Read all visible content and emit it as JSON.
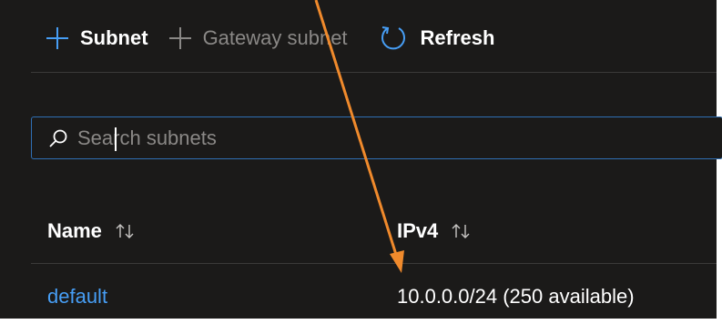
{
  "toolbar": {
    "subnet_label": "Subnet",
    "gateway_label": "Gateway subnet",
    "refresh_label": "Refresh"
  },
  "search": {
    "placeholder": "Search subnets",
    "value": ""
  },
  "table": {
    "columns": [
      {
        "label": "Name",
        "sortable": true
      },
      {
        "label": "IPv4",
        "sortable": true
      }
    ],
    "rows": [
      {
        "name": "default",
        "ipv4": "10.0.0.0/24 (250 available)"
      }
    ]
  },
  "colors": {
    "background": "#1b1a19",
    "link": "#479ef5",
    "accent_icon": "#479ef5",
    "search_border": "#2f6fb3",
    "disabled_text": "#8a8886",
    "annotation_arrow": "#f08a2c"
  },
  "icons": {
    "subnet": "plus-icon",
    "gateway": "plus-icon",
    "refresh": "refresh-icon",
    "search": "search-icon",
    "sort": "sort-arrows-icon"
  }
}
